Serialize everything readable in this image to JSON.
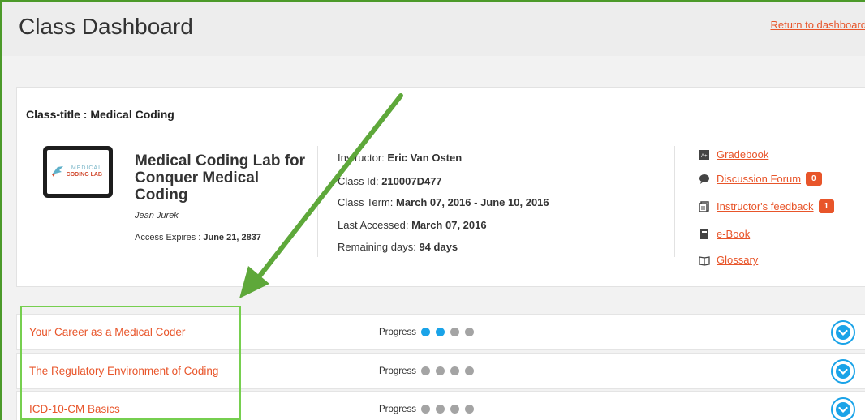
{
  "header": {
    "title": "Class Dashboard",
    "return_link": "Return to dashboard"
  },
  "class_card": {
    "class_title": "Class-title : Medical Coding",
    "thumbnail": {
      "logo_line1": "MEDICAL",
      "logo_line2": "CODING LAB",
      "icon": "bird-logo-icon"
    },
    "course_name": "Medical Coding Lab for Conquer Medical Coding",
    "author": "Jean Jurek",
    "access_expires_label": "Access Expires :",
    "access_expires_value": "June 21, 2837",
    "info": {
      "instructor_label": "Instructor:",
      "instructor_value": "Eric Van Osten",
      "class_id_label": "Class Id:",
      "class_id_value": "210007D477",
      "class_term_label": "Class Term:",
      "class_term_value": "March 07, 2016 - June 10, 2016",
      "last_accessed_label": "Last Accessed:",
      "last_accessed_value": "March 07, 2016",
      "remaining_label": "Remaining days:",
      "remaining_value": "94 days"
    },
    "side_links": [
      {
        "label": "Gradebook",
        "icon": "gradebook-icon"
      },
      {
        "label": "Discussion Forum",
        "icon": "chat-bubble-icon",
        "badge": "0"
      },
      {
        "label": "Instructor's feedback",
        "icon": "feedback-icon",
        "badge": "1"
      },
      {
        "label": "e-Book",
        "icon": "book-icon"
      },
      {
        "label": "Glossary",
        "icon": "open-book-icon"
      }
    ]
  },
  "lessons": [
    {
      "title": "Your Career as a Medical Coder",
      "progress_label": "Progress",
      "progress_filled": 2,
      "progress_total": 4
    },
    {
      "title": "The Regulatory Environment of Coding",
      "progress_label": "Progress",
      "progress_filled": 0,
      "progress_total": 4
    },
    {
      "title": "ICD-10-CM Basics",
      "progress_label": "Progress",
      "progress_filled": 0,
      "progress_total": 4
    }
  ],
  "colors": {
    "accent": "#e8552a",
    "progress_on": "#1aa3e8",
    "progress_off": "#a4a4a4",
    "annotation_green": "#5ea83a",
    "highlight_box": "#76cf4f"
  }
}
